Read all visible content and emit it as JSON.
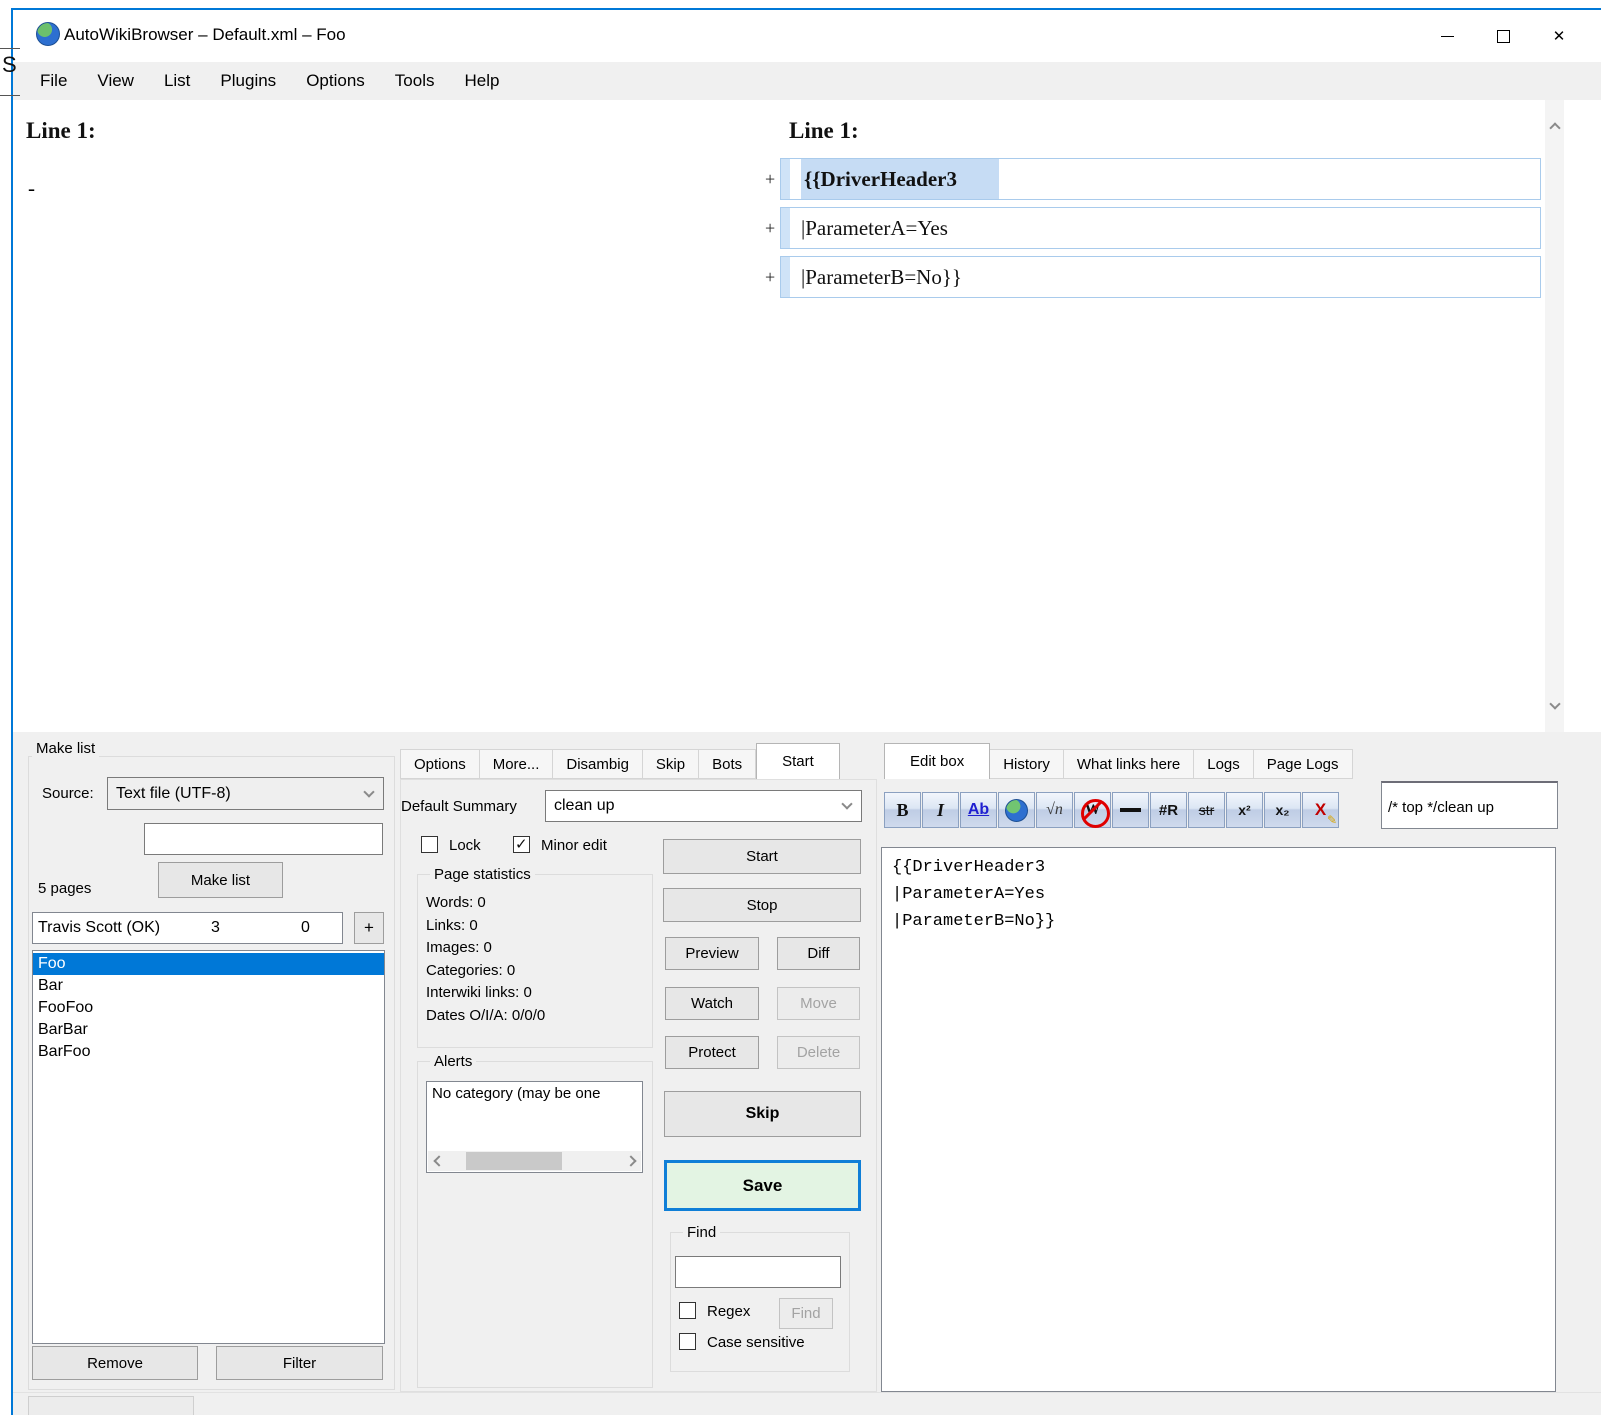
{
  "background_window": {
    "letter": "S"
  },
  "window": {
    "title": "AutoWikiBrowser – Default.xml – Foo",
    "close_glyph": "✕"
  },
  "menu_items": [
    {
      "name": "menu-file",
      "label": "File"
    },
    {
      "name": "menu-view",
      "label": "View"
    },
    {
      "name": "menu-list",
      "label": "List"
    },
    {
      "name": "menu-plugins",
      "label": "Plugins"
    },
    {
      "name": "menu-options",
      "label": "Options"
    },
    {
      "name": "menu-tools",
      "label": "Tools"
    },
    {
      "name": "menu-help",
      "label": "Help"
    }
  ],
  "diff": {
    "left_header": "Line 1:",
    "removed_marker": "-",
    "right_header": "Line 1:",
    "added_lines": [
      {
        "name": "diff-added-line-1",
        "label": "{{DriverHeader3",
        "marker": "+",
        "bold": true,
        "highlight": true
      },
      {
        "name": "diff-added-line-2",
        "label": "|ParameterA=Yes",
        "marker": "+"
      },
      {
        "name": "diff-added-line-3",
        "label": "|ParameterB=No}}",
        "marker": "+"
      }
    ]
  },
  "make_list": {
    "group_title": "Make list",
    "source_label": "Source:",
    "source_value": "Text file (UTF-8)",
    "pages_count": "5 pages",
    "make_list_button": "Make list",
    "provider": {
      "name_col": "Travis Scott (OK)",
      "col_a": "3",
      "col_b": "0"
    },
    "add_button": "+",
    "pages": [
      {
        "name": "page-item-foo",
        "label": "Foo",
        "selected": true
      },
      {
        "name": "page-item-bar",
        "label": "Bar"
      },
      {
        "name": "page-item-foofoo",
        "label": "FooFoo"
      },
      {
        "name": "page-item-barbar",
        "label": "BarBar"
      },
      {
        "name": "page-item-barfoo",
        "label": "BarFoo"
      }
    ],
    "remove_button": "Remove",
    "filter_button": "Filter"
  },
  "middle": {
    "tabs": [
      {
        "name": "tab-options",
        "label": "Options"
      },
      {
        "name": "tab-more",
        "label": "More..."
      },
      {
        "name": "tab-disambig",
        "label": "Disambig"
      },
      {
        "name": "tab-skip",
        "label": "Skip"
      },
      {
        "name": "tab-bots",
        "label": "Bots"
      },
      {
        "name": "tab-start",
        "label": "Start",
        "active": true
      }
    ],
    "default_summary_label": "Default Summary",
    "default_summary_value": "clean up",
    "lock_label": "Lock",
    "minor_edit_label": "Minor edit",
    "start_button": "Start",
    "stop_button": "Stop",
    "preview_button": "Preview",
    "diff_button": "Diff",
    "watch_button": "Watch",
    "move_button": "Move",
    "protect_button": "Protect",
    "delete_button": "Delete",
    "skip_button": "Skip",
    "save_button": "Save",
    "page_statistics": {
      "title": "Page statistics",
      "lines": [
        "Words: 0",
        "Links: 0",
        "Images: 0",
        "Categories: 0",
        "Interwiki links: 0",
        "Dates O/I/A: 0/0/0"
      ]
    },
    "alerts": {
      "title": "Alerts",
      "items": [
        {
          "name": "alert-item-no-category",
          "label": "No category (may be one"
        }
      ]
    },
    "find": {
      "title": "Find",
      "regex_label": "Regex",
      "find_button": "Find",
      "case_label": "Case sensitive"
    }
  },
  "editor": {
    "tabs": [
      {
        "name": "tab-edit-box",
        "label": "Edit box",
        "active": true
      },
      {
        "name": "tab-history",
        "label": "History"
      },
      {
        "name": "tab-what-links-here",
        "label": "What links here"
      },
      {
        "name": "tab-logs",
        "label": "Logs"
      },
      {
        "name": "tab-page-logs",
        "label": "Page Logs"
      }
    ],
    "toolbar": [
      {
        "name": "bold-icon",
        "label": "B",
        "cls": "tb-bold"
      },
      {
        "name": "italic-icon",
        "label": "I",
        "cls": "tb-italic"
      },
      {
        "name": "underline-ab-icon",
        "label": "Ab",
        "cls": "tb-ab"
      },
      {
        "name": "wiki-globe-icon",
        "label": "",
        "cls": "tb-globe"
      },
      {
        "name": "math-formula-icon",
        "label": "√n",
        "cls": "tb-math"
      },
      {
        "name": "nowiki-icon",
        "label": "W",
        "cls": "tb-nowiki"
      },
      {
        "name": "horizontal-rule-icon",
        "label": "",
        "cls": "tb-hr"
      },
      {
        "name": "redirect-icon",
        "label": "#R",
        "cls": "tb-redirect"
      },
      {
        "name": "strikethrough-icon",
        "label": "str",
        "cls": "tb-str"
      },
      {
        "name": "superscript-icon",
        "label": "x²",
        "cls": "tb-sup"
      },
      {
        "name": "subscript-icon",
        "label": "x₂",
        "cls": "tb-sub"
      },
      {
        "name": "delete-markup-icon",
        "label": "X",
        "cls": "tb-del"
      }
    ],
    "summary_value": "/* top */clean up",
    "content": "{{DriverHeader3\n|ParameterA=Yes\n|ParameterB=No}}"
  },
  "colors": {
    "accent": "#0078d7",
    "selection": "#0078d7",
    "save_button_bg": "#e3f4e3",
    "diff_border": "#a9cbec",
    "diff_highlight": "#c6dcf4"
  }
}
